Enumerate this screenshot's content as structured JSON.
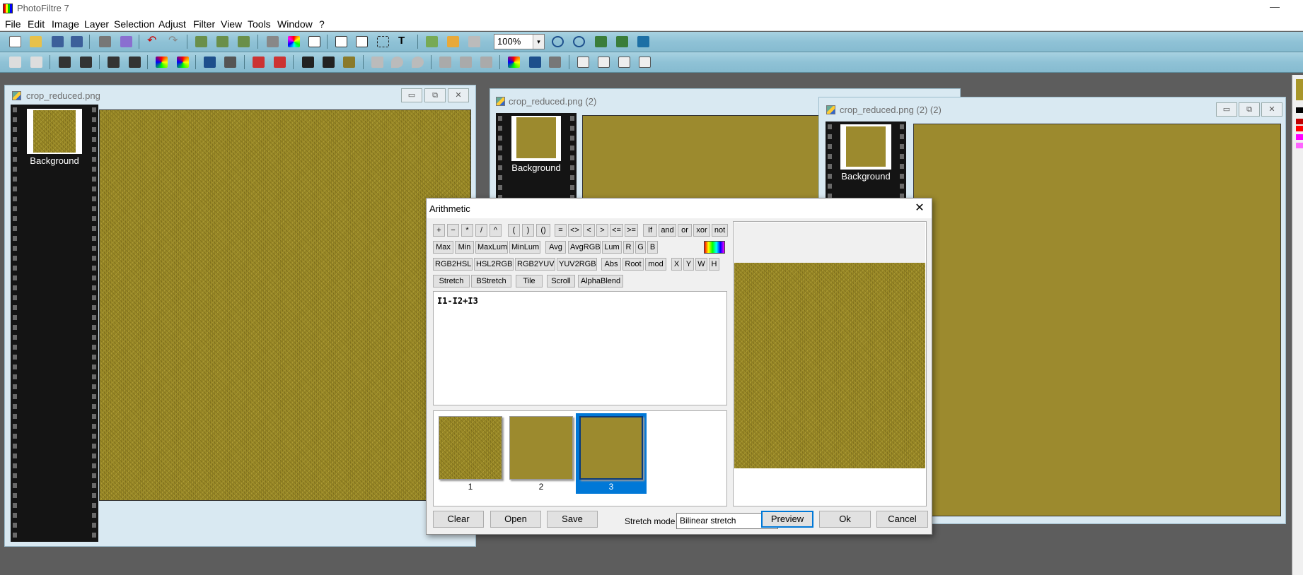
{
  "app": {
    "title": "PhotoFiltre 7",
    "minimize_glyph": "—"
  },
  "menu": [
    "File",
    "Edit",
    "Image",
    "Layer",
    "Selection",
    "Adjust",
    "Filter",
    "View",
    "Tools",
    "Window",
    "?"
  ],
  "toolbar": {
    "zoom_value": "100%",
    "zoom_arrow": "▾"
  },
  "windows": [
    {
      "title": "crop_reduced.png",
      "layer_label": "Background"
    },
    {
      "title": "crop_reduced.png (2)",
      "layer_label": "Background"
    },
    {
      "title": "crop_reduced.png (2) (2)",
      "layer_label": "Background"
    }
  ],
  "window_buttons": {
    "minimize": "▭",
    "restore": "⧉",
    "close": "✕"
  },
  "dialog": {
    "title": "Arithmetic",
    "close_glyph": "✕",
    "row1": [
      "+",
      "−",
      "*",
      "/",
      "^",
      "(",
      ")",
      "()",
      "=",
      "<>",
      "<",
      ">",
      "<=",
      ">=",
      "If",
      "and",
      "or",
      "xor",
      "not"
    ],
    "row2": [
      "Max",
      "Min",
      "MaxLum",
      "MinLum",
      "Avg",
      "AvgRGB",
      "Lum",
      "R",
      "G",
      "B"
    ],
    "row3": [
      "RGB2HSL",
      "HSL2RGB",
      "RGB2YUV",
      "YUV2RGB",
      "Abs",
      "Root",
      "mod",
      "X",
      "Y",
      "W",
      "H"
    ],
    "row4": [
      "Stretch",
      "BStretch",
      "Tile",
      "Scroll",
      "AlphaBlend"
    ],
    "formula": "I1-I2+I3",
    "images": [
      {
        "number": "1",
        "selected": false
      },
      {
        "number": "2",
        "selected": false
      },
      {
        "number": "3",
        "selected": true
      }
    ],
    "buttons": {
      "clear": "Clear",
      "open": "Open",
      "save": "Save",
      "preview": "Preview",
      "ok": "Ok",
      "cancel": "Cancel"
    },
    "stretch_label": "Stretch mode :",
    "stretch_value": "Bilinear stretch",
    "stretch_arrow": "⌄"
  },
  "colors": {
    "toolbar_bg": "#8fc2d6",
    "texture_olive": "#9b8a27",
    "selected_blue": "#0078d7",
    "workspace": "#5d5d5d"
  },
  "palette_swatches": [
    "#c8b400",
    "#000000",
    "#c00000",
    "#ff0000",
    "#ff00ff",
    "#ff66ff",
    "#ffffff"
  ]
}
